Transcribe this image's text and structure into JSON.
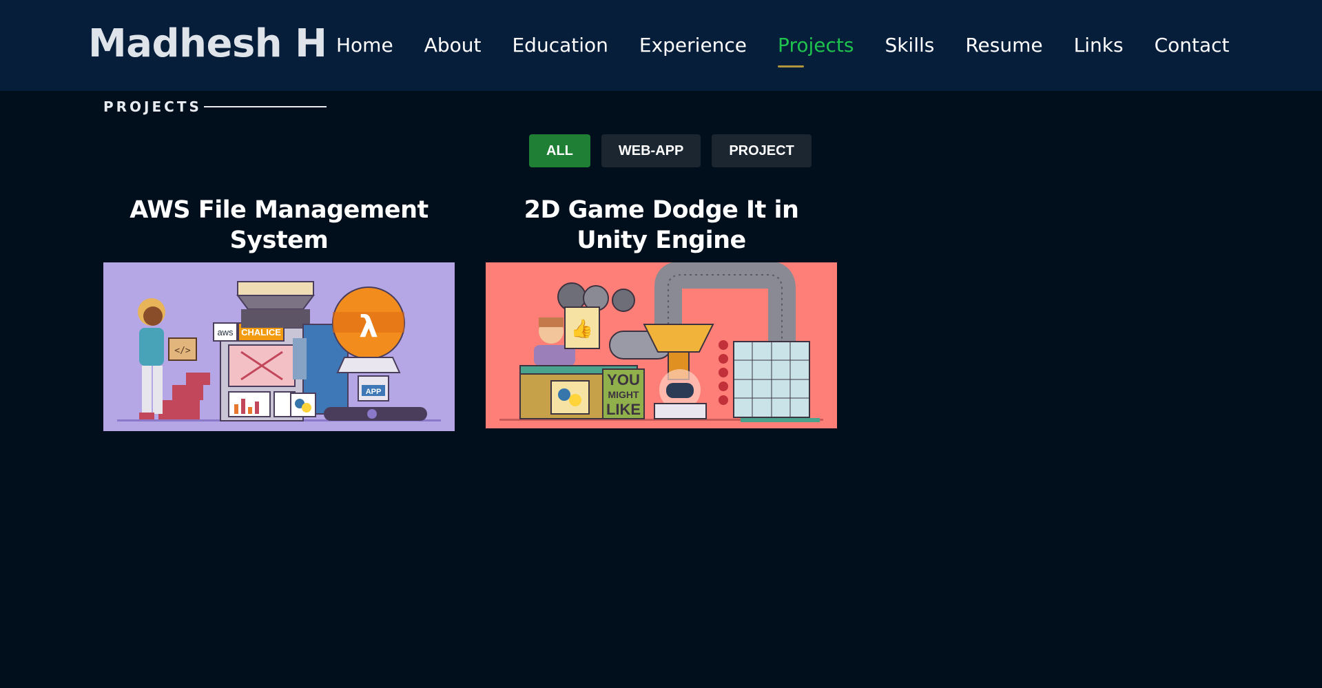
{
  "brand": "Madhesh H",
  "nav": [
    {
      "label": "Home"
    },
    {
      "label": "About"
    },
    {
      "label": "Education"
    },
    {
      "label": "Experience"
    },
    {
      "label": "Projects",
      "active": true
    },
    {
      "label": "Skills"
    },
    {
      "label": "Resume"
    },
    {
      "label": "Links"
    },
    {
      "label": "Contact"
    }
  ],
  "section": {
    "title": "PROJECTS"
  },
  "filters": [
    {
      "label": "ALL",
      "active": true
    },
    {
      "label": "WEB-APP"
    },
    {
      "label": "PROJECT"
    }
  ],
  "projects": [
    {
      "title": "AWS File Management System",
      "image_labels": {
        "aws": "aws",
        "chalice": "CHALICE",
        "lambda": "λ",
        "app": "APP",
        "code": "</>"
      }
    },
    {
      "title": "2D Game Dodge It in Unity Engine",
      "image_labels": {
        "you": "YOU",
        "might": "MIGHT",
        "like": "LIKE"
      }
    }
  ],
  "colors": {
    "header_bg": "#071e3b",
    "page_bg": "#010e1b",
    "nav_active": "#1ec34d",
    "nav_underline": "#b2963d",
    "filter_active": "#1e7f35",
    "filter_bg": "#1b2631",
    "card1_bg": "#b5a6e6",
    "card2_bg": "#fd7f78"
  },
  "icons": [
    "lambda-icon",
    "python-logo-icon",
    "gamepad-icon",
    "thumbs-up-icon",
    "aws-logo-icon"
  ]
}
